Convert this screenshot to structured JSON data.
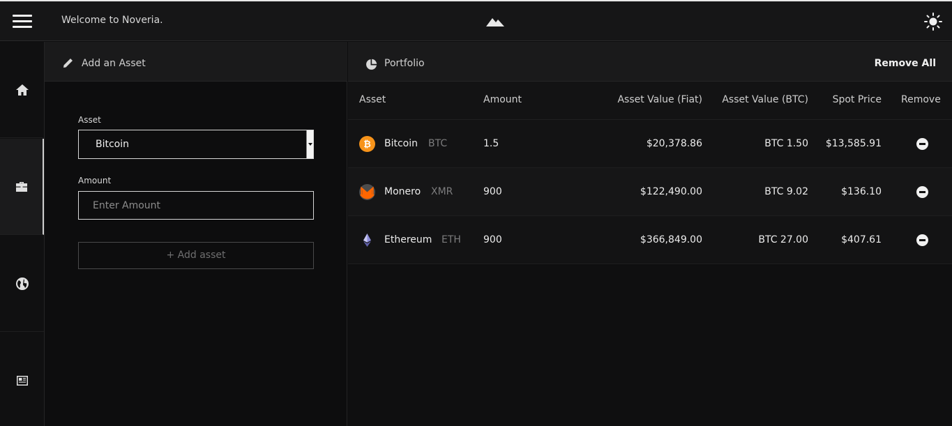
{
  "header": {
    "welcome": "Welcome to Noveria.",
    "menu_icon": "hamburger-menu-icon",
    "logo_icon": "mountain-logo-icon",
    "theme_icon": "sun-icon"
  },
  "sidebar": {
    "items": [
      {
        "icon": "home-icon",
        "active": false
      },
      {
        "icon": "briefcase-icon",
        "active": true
      },
      {
        "icon": "globe-icon",
        "active": false
      },
      {
        "icon": "news-icon",
        "active": false
      }
    ]
  },
  "add_asset": {
    "title": "Add an Asset",
    "asset_label": "Asset",
    "asset_value": "Bitcoin",
    "amount_label": "Amount",
    "amount_placeholder": "Enter Amount",
    "add_button": "+ Add asset"
  },
  "portfolio": {
    "title": "Portfolio",
    "remove_all": "Remove All",
    "columns": {
      "asset": "Asset",
      "amount": "Amount",
      "fiat": "Asset Value (Fiat)",
      "btc": "Asset Value (BTC)",
      "spot": "Spot Price",
      "remove": "Remove"
    },
    "rows": [
      {
        "name": "Bitcoin",
        "symbol": "BTC",
        "amount": "1.5",
        "fiat": "$20,378.86",
        "btc": "BTC 1.50",
        "spot": "$13,585.91",
        "icon": "bitcoin-icon",
        "color": "#f7931a"
      },
      {
        "name": "Monero",
        "symbol": "XMR",
        "amount": "900",
        "fiat": "$122,490.00",
        "btc": "BTC 9.02",
        "spot": "$136.10",
        "icon": "monero-icon",
        "color": "#ff6600"
      },
      {
        "name": "Ethereum",
        "symbol": "ETH",
        "amount": "900",
        "fiat": "$366,849.00",
        "btc": "BTC 27.00",
        "spot": "$407.61",
        "icon": "ethereum-icon",
        "color": "#8c8cd9"
      }
    ]
  }
}
